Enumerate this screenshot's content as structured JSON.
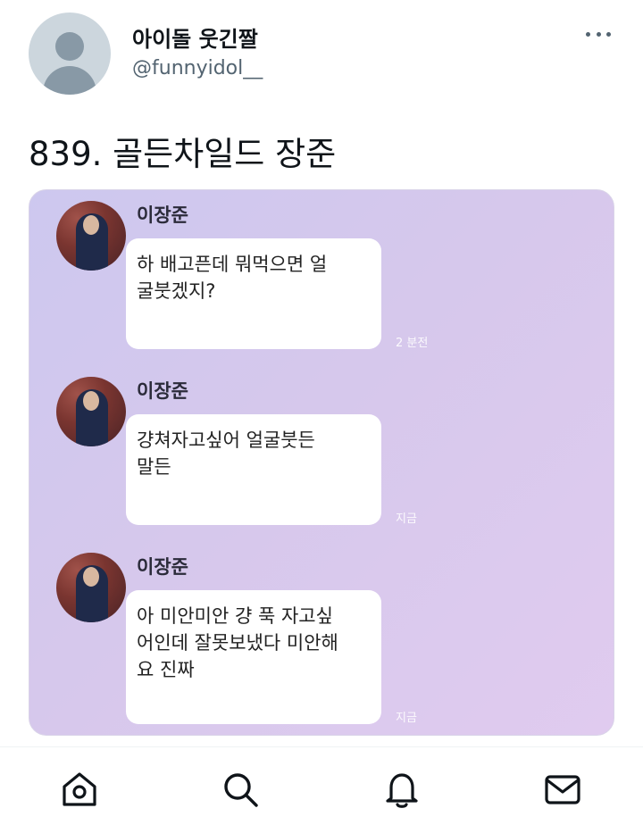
{
  "tweet": {
    "display_name": "아이돌 웃긴짤",
    "handle": "@funnyidol__",
    "text": "839. 골든차일드 장준"
  },
  "media": {
    "messages": [
      {
        "sender": "이장준",
        "text": "하 배고픈데 뭐먹으면 얼\n굴붓겠지?",
        "time": "2 분전"
      },
      {
        "sender": "이장준",
        "text": "걍쳐자고싶어 얼굴붓든\n말든",
        "time": "지금"
      },
      {
        "sender": "이장준",
        "text": "아 미안미안 걍 푹 자고싶\n어인데 잘못보냈다 미안해\n요 진짜",
        "time": "지금"
      }
    ]
  },
  "tabbar": {
    "items": [
      "home-icon",
      "search-icon",
      "notifications-icon",
      "messages-icon"
    ]
  }
}
